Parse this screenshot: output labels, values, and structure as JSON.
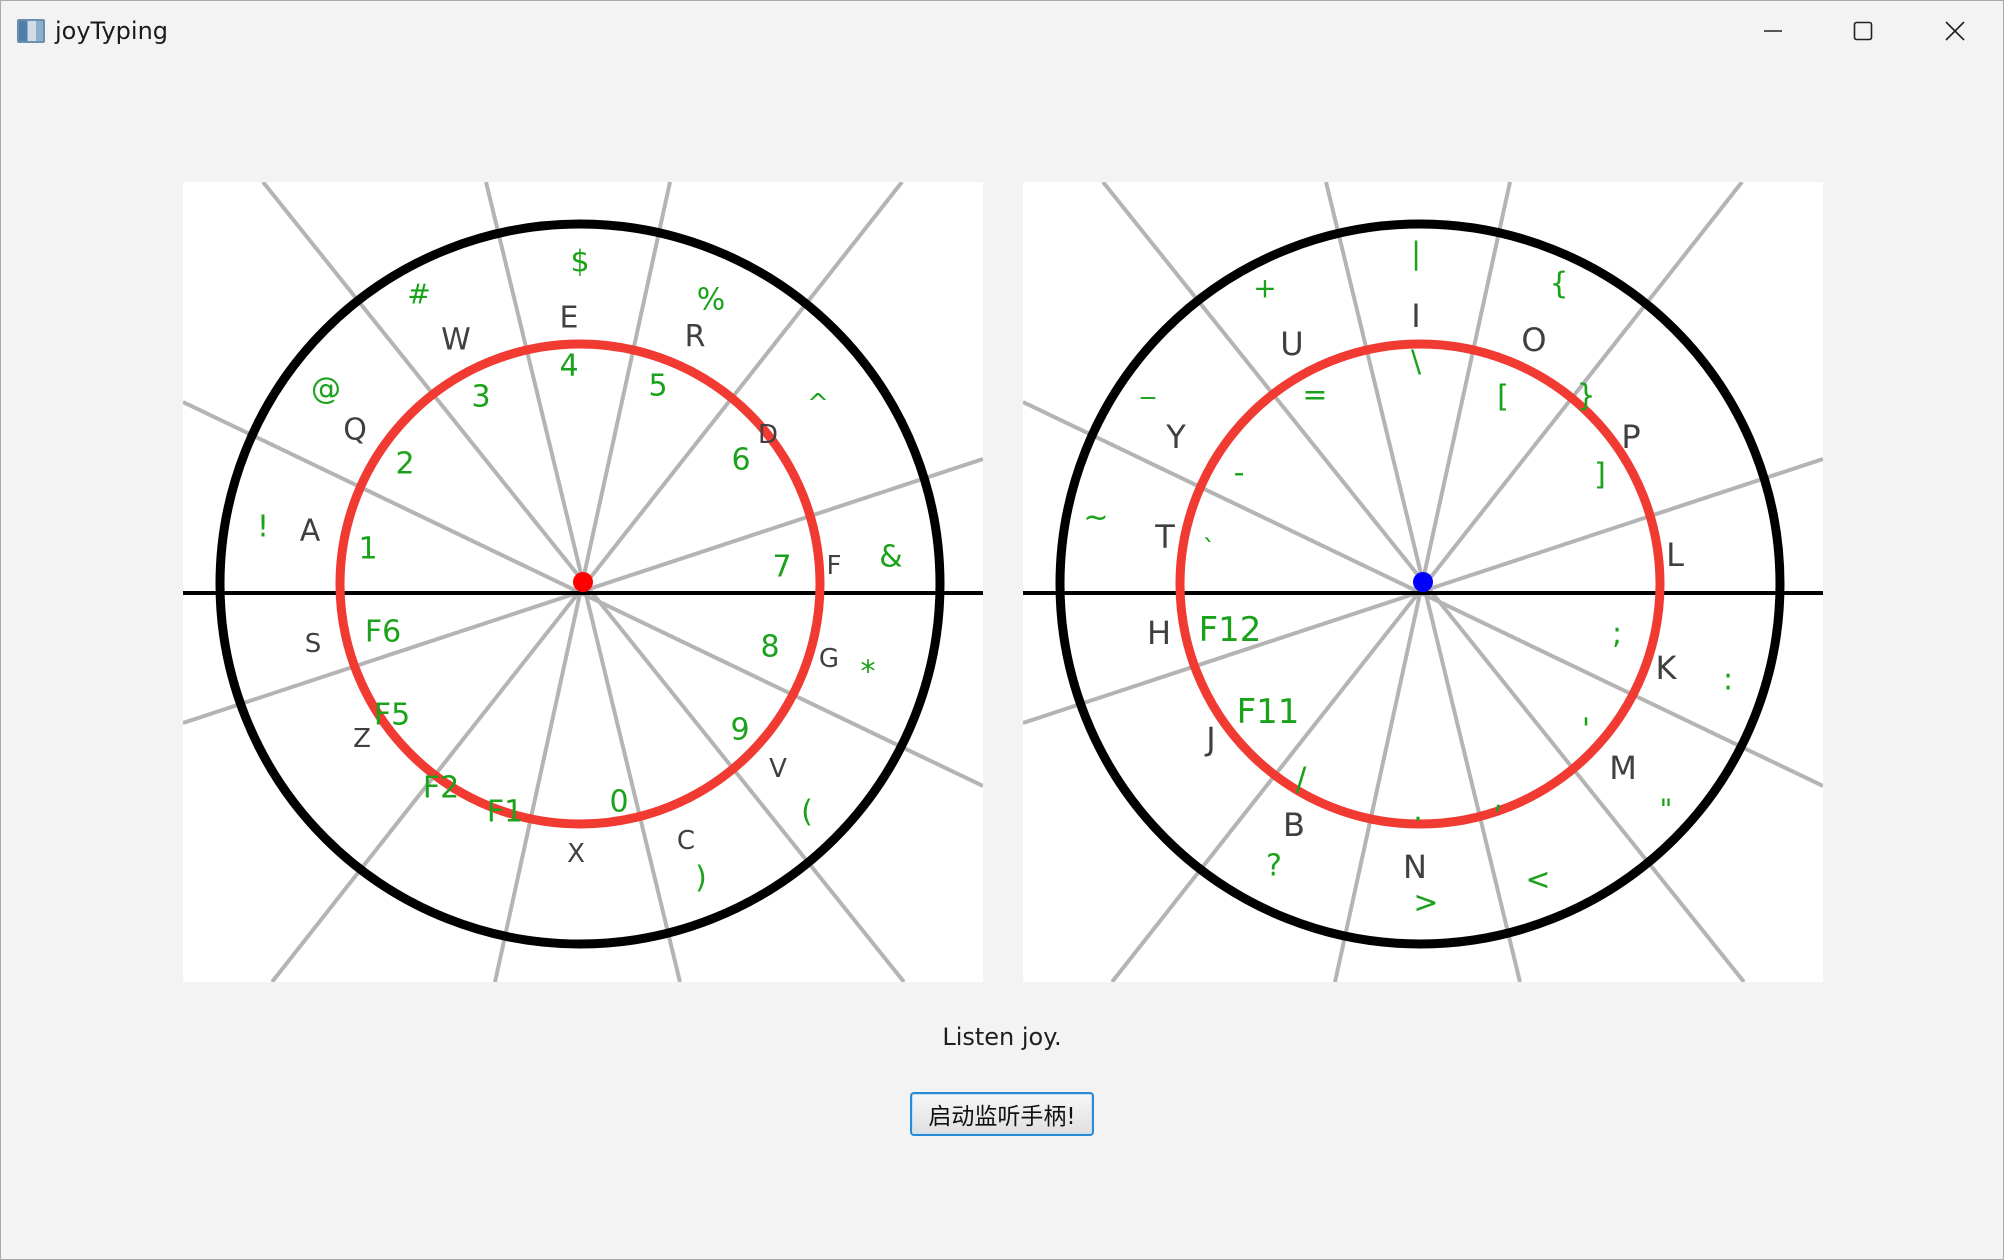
{
  "window": {
    "title": "joyTyping",
    "app_icon": "joytyping-app-icon",
    "controls": {
      "minimize": "minimize-icon",
      "maximize": "maximize-icon",
      "close": "close-icon"
    }
  },
  "colors": {
    "window_bg": "#f3f3f3",
    "panel_bg": "#ffffff",
    "outer_ring": "#000000",
    "inner_ring": "#f03a32",
    "spoke": "#b4b4b4",
    "letter": "#404040",
    "symbol": "#1aa31a",
    "left_center_dot": "#ff0000",
    "right_center_dot": "#0000ff"
  },
  "left_wheel": {
    "center_dot": "red",
    "labels": [
      {
        "text": "$",
        "kind": "symbol"
      },
      {
        "text": "#",
        "kind": "symbol"
      },
      {
        "text": "%",
        "kind": "symbol"
      },
      {
        "text": "E",
        "kind": "letter"
      },
      {
        "text": "W",
        "kind": "letter"
      },
      {
        "text": "R",
        "kind": "letter"
      },
      {
        "text": "4",
        "kind": "symbol"
      },
      {
        "text": "3",
        "kind": "symbol"
      },
      {
        "text": "5",
        "kind": "symbol"
      },
      {
        "text": "@",
        "kind": "symbol"
      },
      {
        "text": "Q",
        "kind": "letter"
      },
      {
        "text": "2",
        "kind": "symbol"
      },
      {
        "text": "D",
        "kind": "letter"
      },
      {
        "text": "^",
        "kind": "symbol"
      },
      {
        "text": "6",
        "kind": "symbol"
      },
      {
        "text": "!",
        "kind": "symbol"
      },
      {
        "text": "A",
        "kind": "letter"
      },
      {
        "text": "1",
        "kind": "symbol"
      },
      {
        "text": "7",
        "kind": "symbol"
      },
      {
        "text": "F",
        "kind": "letter"
      },
      {
        "text": "&",
        "kind": "symbol"
      },
      {
        "text": "S",
        "kind": "letter"
      },
      {
        "text": "F6",
        "kind": "symbol"
      },
      {
        "text": "8",
        "kind": "symbol"
      },
      {
        "text": "G",
        "kind": "letter"
      },
      {
        "text": "*",
        "kind": "symbol"
      },
      {
        "text": "F5",
        "kind": "symbol"
      },
      {
        "text": "Z",
        "kind": "letter"
      },
      {
        "text": "9",
        "kind": "symbol"
      },
      {
        "text": "V",
        "kind": "letter"
      },
      {
        "text": "F2",
        "kind": "symbol"
      },
      {
        "text": "F1",
        "kind": "symbol"
      },
      {
        "text": "0",
        "kind": "symbol"
      },
      {
        "text": "(",
        "kind": "symbol"
      },
      {
        "text": "C",
        "kind": "letter"
      },
      {
        "text": "X",
        "kind": "letter"
      },
      {
        "text": ")",
        "kind": "symbol"
      }
    ]
  },
  "right_wheel": {
    "center_dot": "blue",
    "labels": [
      {
        "text": "|",
        "kind": "symbol"
      },
      {
        "text": "+",
        "kind": "symbol"
      },
      {
        "text": "{",
        "kind": "symbol"
      },
      {
        "text": "I",
        "kind": "letter"
      },
      {
        "text": "U",
        "kind": "letter"
      },
      {
        "text": "O",
        "kind": "letter"
      },
      {
        "text": "\\",
        "kind": "symbol"
      },
      {
        "text": "_",
        "kind": "symbol"
      },
      {
        "text": "=",
        "kind": "symbol"
      },
      {
        "text": "[",
        "kind": "symbol"
      },
      {
        "text": "}",
        "kind": "symbol"
      },
      {
        "text": "Y",
        "kind": "letter"
      },
      {
        "text": "P",
        "kind": "letter"
      },
      {
        "text": "-",
        "kind": "symbol"
      },
      {
        "text": "]",
        "kind": "symbol"
      },
      {
        "text": "~",
        "kind": "symbol"
      },
      {
        "text": "T",
        "kind": "letter"
      },
      {
        "text": "`",
        "kind": "symbol"
      },
      {
        "text": "L",
        "kind": "letter"
      },
      {
        "text": "H",
        "kind": "letter"
      },
      {
        "text": "F12",
        "kind": "symbol"
      },
      {
        "text": ";",
        "kind": "symbol"
      },
      {
        "text": "K",
        "kind": "letter"
      },
      {
        "text": ":",
        "kind": "symbol"
      },
      {
        "text": "F11",
        "kind": "symbol"
      },
      {
        "text": "J",
        "kind": "letter"
      },
      {
        "text": "'",
        "kind": "symbol"
      },
      {
        "text": "M",
        "kind": "letter"
      },
      {
        "text": "/",
        "kind": "symbol"
      },
      {
        "text": "\"",
        "kind": "symbol"
      },
      {
        "text": ",",
        "kind": "symbol"
      },
      {
        "text": ".",
        "kind": "symbol"
      },
      {
        "text": "B",
        "kind": "letter"
      },
      {
        "text": "N",
        "kind": "letter"
      },
      {
        "text": "?",
        "kind": "symbol"
      },
      {
        "text": "<",
        "kind": "symbol"
      },
      {
        "text": ">",
        "kind": "symbol"
      }
    ]
  },
  "status": "Listen joy.",
  "start_button": "启动监听手柄!"
}
